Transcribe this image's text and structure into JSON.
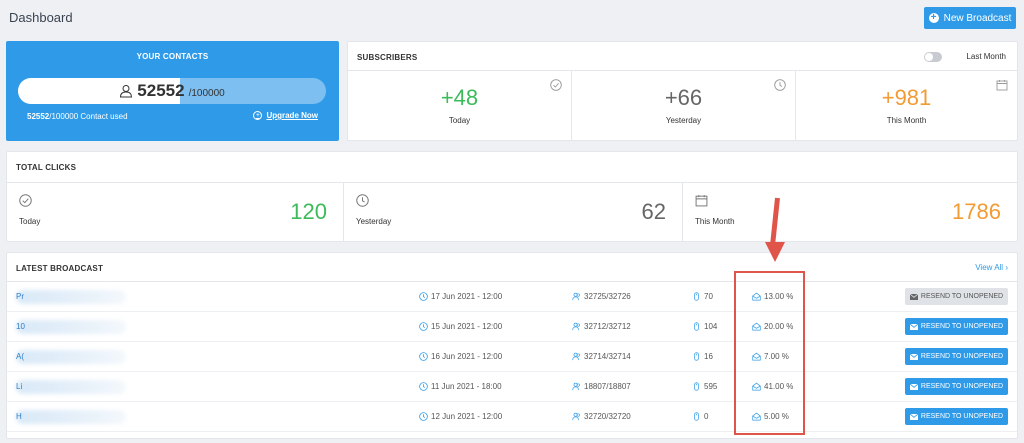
{
  "header": {
    "title": "Dashboard",
    "new_broadcast_label": "New Broadcast"
  },
  "contacts": {
    "title": "YOUR CONTACTS",
    "count": "52552",
    "total": "/100000",
    "used_count": "52552",
    "used_text": "/100000 Contact used",
    "usage_fraction": 0.52552,
    "upgrade_label": "Upgrade Now"
  },
  "subscribers": {
    "title": "SUBSCRIBERS",
    "toggle_label": "Last Month",
    "cells": [
      {
        "value": "+48",
        "label": "Today",
        "color": "#3dbb5a",
        "icon": "check-circle-icon"
      },
      {
        "value": "+66",
        "label": "Yesterday",
        "color": "#666666",
        "icon": "clock-icon"
      },
      {
        "value": "+981",
        "label": "This Month",
        "color": "#f29b35",
        "icon": "calendar-icon"
      }
    ]
  },
  "total_clicks": {
    "title": "TOTAL CLICKS",
    "cells": [
      {
        "value": "120",
        "label": "Today",
        "color": "#3dbb5a",
        "icon": "check-circle-icon"
      },
      {
        "value": "62",
        "label": "Yesterday",
        "color": "#666666",
        "icon": "clock-icon"
      },
      {
        "value": "1786",
        "label": "This Month",
        "color": "#f29b35",
        "icon": "calendar-icon"
      }
    ]
  },
  "latest": {
    "title": "LATEST BROADCAST",
    "view_all_label": "View All",
    "resend_label": "RESEND TO UNOPENED",
    "rows": [
      {
        "name": "Pr",
        "date": "17 Jun 2021 - 12:00",
        "ratio": "32725/32726",
        "clicks": "70",
        "rate": "13.00 %",
        "resend_disabled": true
      },
      {
        "name": "10",
        "date": "15 Jun 2021 - 12:00",
        "ratio": "32712/32712",
        "clicks": "104",
        "rate": "20.00 %",
        "resend_disabled": false
      },
      {
        "name": "A(",
        "date": "16 Jun 2021 - 12:00",
        "ratio": "32714/32714",
        "clicks": "16",
        "rate": "7.00 %",
        "resend_disabled": false
      },
      {
        "name": "Li",
        "date": "11 Jun 2021 - 18:00",
        "ratio": "18807/18807",
        "clicks": "595",
        "rate": "41.00 %",
        "resend_disabled": false
      },
      {
        "name": "H",
        "date": "12 Jun 2021 - 12:00",
        "ratio": "32720/32720",
        "clicks": "0",
        "rate": "5.00 %",
        "resend_disabled": false
      }
    ]
  },
  "colors": {
    "accent": "#2f9be8",
    "annotation": "#e0554a"
  }
}
